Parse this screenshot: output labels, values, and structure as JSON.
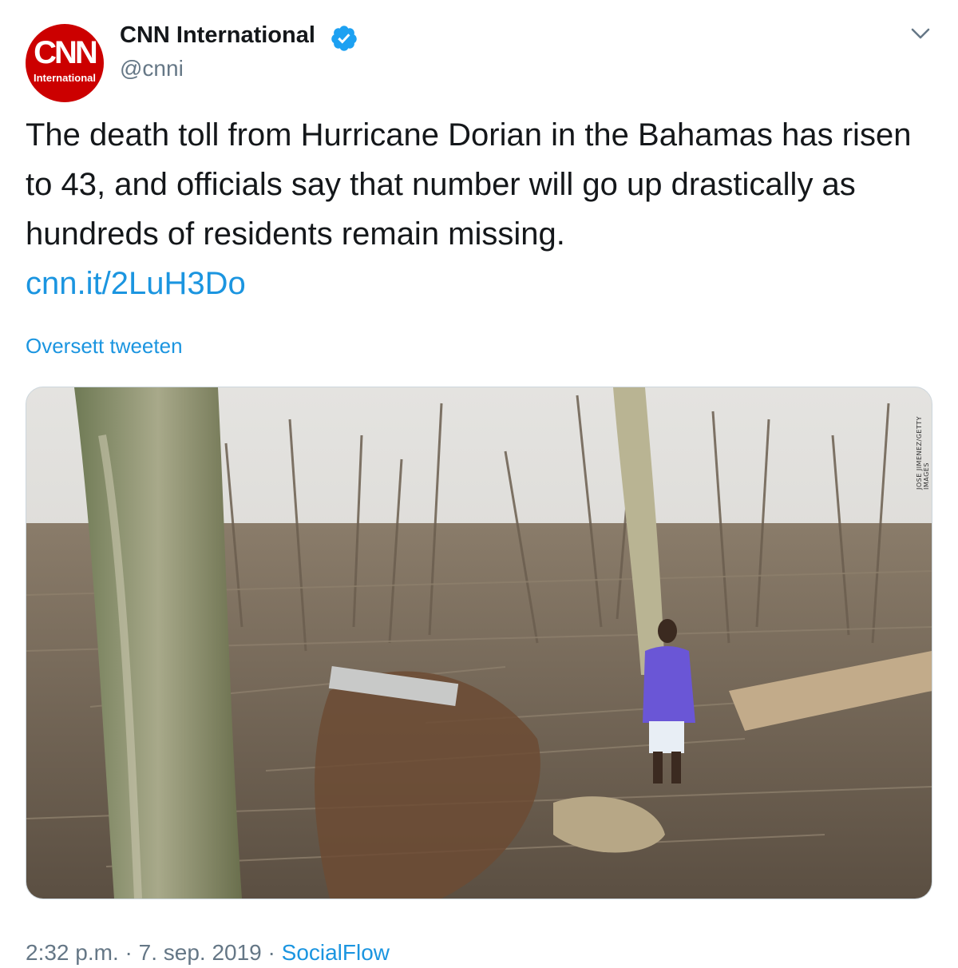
{
  "author": {
    "display_name": "CNN International",
    "handle": "@cnni",
    "avatar_logo": "CNN",
    "avatar_subtext": "International",
    "verified": true
  },
  "tweet": {
    "text": "The death toll from Hurricane Dorian in the Bahamas has risen to 43, and officials say that number will go up drastically as hundreds of residents remain missing.",
    "link": "cnn.it/2LuH3Do",
    "translate_label": "Oversett tweeten",
    "media_credit": "JOSE JIMENEZ/GETTY IMAGES"
  },
  "meta": {
    "time": "2:32 p.m.",
    "sep1": "·",
    "date": "7. sep. 2019",
    "sep2": "·",
    "source": "SocialFlow"
  },
  "colors": {
    "link": "#1b95e0",
    "secondary": "#657786",
    "text": "#14171a",
    "brand_red": "#cc0000"
  },
  "icons": {
    "verified": "verified-badge-icon",
    "menu": "chevron-down-icon"
  }
}
